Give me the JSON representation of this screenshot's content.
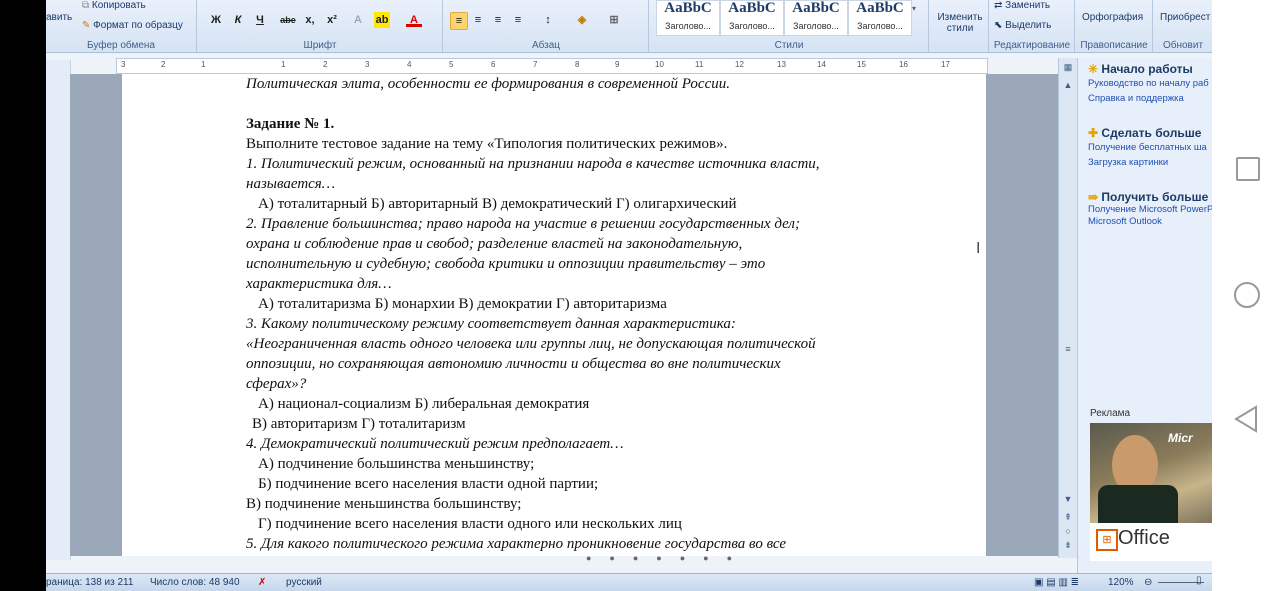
{
  "ribbon": {
    "clipboard": {
      "paste_partial": "авить",
      "copy": "Копировать",
      "format_painter": "Формат по образцу",
      "label": "Буфер обмена"
    },
    "font": {
      "label": "Шрифт",
      "bold": "Ж",
      "italic": "К",
      "underline": "Ч",
      "strike": "abe",
      "sub": "x,",
      "sup": "x²",
      "color": "A"
    },
    "paragraph": {
      "label": "Абзац"
    },
    "styles": {
      "label": "Стили",
      "tiles": [
        {
          "big": "AaBbC",
          "small": "Заголово..."
        },
        {
          "big": "AaBbC",
          "small": "Заголово..."
        },
        {
          "big": "AaBbC",
          "small": "Заголово..."
        },
        {
          "big": "AaBbC",
          "small": "Заголово..."
        }
      ],
      "change_styles": "Изменить стили"
    },
    "editing": {
      "replace": "Заменить",
      "select": "Выделить",
      "label": "Редактирование"
    },
    "spelling": {
      "button": "Орфография",
      "label": "Правописание"
    },
    "acquire": {
      "button": "Приобрест",
      "label": "Обновит"
    }
  },
  "ruler_marks": [
    "3",
    "2",
    "1",
    "1",
    "2",
    "3",
    "4",
    "5",
    "6",
    "7",
    "8",
    "9",
    "10",
    "11",
    "12",
    "13",
    "14",
    "15",
    "16",
    "17"
  ],
  "document": {
    "lines": [
      {
        "text": "Политическая элита, особенности ее формирования в современной России.",
        "style": "it"
      },
      {
        "text": "",
        "style": ""
      },
      {
        "text": "Задание № 1.",
        "style": "b"
      },
      {
        "text": "Выполните тестовое задание на тему «Типология политических режимов».",
        "style": ""
      },
      {
        "text": "1.  Политический режим, основанный на признании народа в качестве источника власти,",
        "style": "it"
      },
      {
        "text": "называется…",
        "style": "it"
      },
      {
        "text": "А) тоталитарный   Б) авторитарный В) демократический   Г) олигархический",
        "style": "ind"
      },
      {
        "text": "2.  Правление большинства; право народа на участие в решении государственных  дел;",
        "style": "it"
      },
      {
        "text": "охрана и соблюдение прав и свобод; разделение властей на законодательную,",
        "style": "it"
      },
      {
        "text": "исполнительную и судебную;  свобода критики и оппозиции правительству – это",
        "style": "it"
      },
      {
        "text": "характеристика для…",
        "style": "it"
      },
      {
        "text": "А) тоталитаризма     Б) монархии      В) демократии      Г) авторитаризма",
        "style": "ind"
      },
      {
        "text": "3.   Какому политическому режиму соответствует  данная характеристика:",
        "style": "it"
      },
      {
        "text": "«Неограниченная власть одного человека или группы лиц, не допускающая политической",
        "style": "it"
      },
      {
        "text": "оппозиции, но сохраняющая автономию личности и общества во вне политических",
        "style": "it"
      },
      {
        "text": "сферах»?",
        "style": "it"
      },
      {
        "text": "А) национал-социализм    Б) либеральная демократия",
        "style": "ind"
      },
      {
        "text": "В) авторитаризм                Г) тоталитаризм",
        "style": "ind2"
      },
      {
        "text": "4.   Демократический политический режим предполагает…",
        "style": "it"
      },
      {
        "text": "А) подчинение большинства меньшинству;",
        "style": "ind"
      },
      {
        "text": "Б) подчинение всего населения власти одной партии;",
        "style": "ind"
      },
      {
        "text": "В) подчинение меньшинства большинству;",
        "style": ""
      },
      {
        "text": "Г) подчинение всего населения власти одного или нескольких лиц",
        "style": "ind"
      },
      {
        "text": "5.  Для какого политического режима характерно проникновение государства во все",
        "style": "it"
      }
    ]
  },
  "task_pane": {
    "sections": [
      {
        "title": "Начало работы",
        "links": [
          "Руководство по началу раб",
          "Справка и поддержка"
        ]
      },
      {
        "title": "Сделать больше",
        "links": [
          "Получение бесплатных ша",
          "Загрузка картинки"
        ]
      },
      {
        "title": "Получить больше",
        "links": [
          "Получение Microsoft PowerP",
          "Microsoft Outlook"
        ]
      }
    ],
    "ad_label": "Реклама",
    "ad_brand": "Office",
    "ad_micro": "Micr"
  },
  "status": {
    "page": "раница: 138 из 211",
    "words": "Число слов: 48 940",
    "language": "русский",
    "zoom": "120%"
  },
  "colors": {
    "accent": "#15428b",
    "highlight": "#fbd46b"
  }
}
